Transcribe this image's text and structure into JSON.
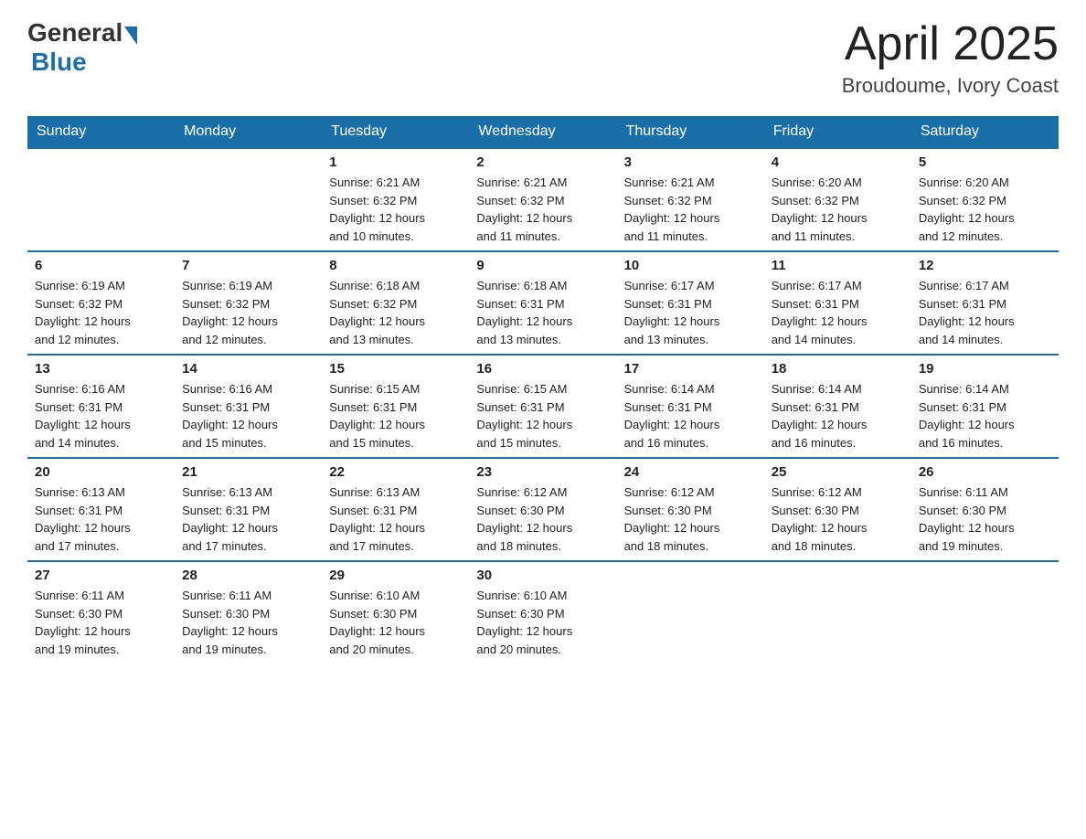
{
  "header": {
    "logo": {
      "general": "General",
      "blue": "Blue"
    },
    "title": "April 2025",
    "location": "Broudoume, Ivory Coast"
  },
  "columns": [
    "Sunday",
    "Monday",
    "Tuesday",
    "Wednesday",
    "Thursday",
    "Friday",
    "Saturday"
  ],
  "weeks": [
    [
      {
        "day": "",
        "info": ""
      },
      {
        "day": "",
        "info": ""
      },
      {
        "day": "1",
        "info": "Sunrise: 6:21 AM\nSunset: 6:32 PM\nDaylight: 12 hours\nand 10 minutes."
      },
      {
        "day": "2",
        "info": "Sunrise: 6:21 AM\nSunset: 6:32 PM\nDaylight: 12 hours\nand 11 minutes."
      },
      {
        "day": "3",
        "info": "Sunrise: 6:21 AM\nSunset: 6:32 PM\nDaylight: 12 hours\nand 11 minutes."
      },
      {
        "day": "4",
        "info": "Sunrise: 6:20 AM\nSunset: 6:32 PM\nDaylight: 12 hours\nand 11 minutes."
      },
      {
        "day": "5",
        "info": "Sunrise: 6:20 AM\nSunset: 6:32 PM\nDaylight: 12 hours\nand 12 minutes."
      }
    ],
    [
      {
        "day": "6",
        "info": "Sunrise: 6:19 AM\nSunset: 6:32 PM\nDaylight: 12 hours\nand 12 minutes."
      },
      {
        "day": "7",
        "info": "Sunrise: 6:19 AM\nSunset: 6:32 PM\nDaylight: 12 hours\nand 12 minutes."
      },
      {
        "day": "8",
        "info": "Sunrise: 6:18 AM\nSunset: 6:32 PM\nDaylight: 12 hours\nand 13 minutes."
      },
      {
        "day": "9",
        "info": "Sunrise: 6:18 AM\nSunset: 6:31 PM\nDaylight: 12 hours\nand 13 minutes."
      },
      {
        "day": "10",
        "info": "Sunrise: 6:17 AM\nSunset: 6:31 PM\nDaylight: 12 hours\nand 13 minutes."
      },
      {
        "day": "11",
        "info": "Sunrise: 6:17 AM\nSunset: 6:31 PM\nDaylight: 12 hours\nand 14 minutes."
      },
      {
        "day": "12",
        "info": "Sunrise: 6:17 AM\nSunset: 6:31 PM\nDaylight: 12 hours\nand 14 minutes."
      }
    ],
    [
      {
        "day": "13",
        "info": "Sunrise: 6:16 AM\nSunset: 6:31 PM\nDaylight: 12 hours\nand 14 minutes."
      },
      {
        "day": "14",
        "info": "Sunrise: 6:16 AM\nSunset: 6:31 PM\nDaylight: 12 hours\nand 15 minutes."
      },
      {
        "day": "15",
        "info": "Sunrise: 6:15 AM\nSunset: 6:31 PM\nDaylight: 12 hours\nand 15 minutes."
      },
      {
        "day": "16",
        "info": "Sunrise: 6:15 AM\nSunset: 6:31 PM\nDaylight: 12 hours\nand 15 minutes."
      },
      {
        "day": "17",
        "info": "Sunrise: 6:14 AM\nSunset: 6:31 PM\nDaylight: 12 hours\nand 16 minutes."
      },
      {
        "day": "18",
        "info": "Sunrise: 6:14 AM\nSunset: 6:31 PM\nDaylight: 12 hours\nand 16 minutes."
      },
      {
        "day": "19",
        "info": "Sunrise: 6:14 AM\nSunset: 6:31 PM\nDaylight: 12 hours\nand 16 minutes."
      }
    ],
    [
      {
        "day": "20",
        "info": "Sunrise: 6:13 AM\nSunset: 6:31 PM\nDaylight: 12 hours\nand 17 minutes."
      },
      {
        "day": "21",
        "info": "Sunrise: 6:13 AM\nSunset: 6:31 PM\nDaylight: 12 hours\nand 17 minutes."
      },
      {
        "day": "22",
        "info": "Sunrise: 6:13 AM\nSunset: 6:31 PM\nDaylight: 12 hours\nand 17 minutes."
      },
      {
        "day": "23",
        "info": "Sunrise: 6:12 AM\nSunset: 6:30 PM\nDaylight: 12 hours\nand 18 minutes."
      },
      {
        "day": "24",
        "info": "Sunrise: 6:12 AM\nSunset: 6:30 PM\nDaylight: 12 hours\nand 18 minutes."
      },
      {
        "day": "25",
        "info": "Sunrise: 6:12 AM\nSunset: 6:30 PM\nDaylight: 12 hours\nand 18 minutes."
      },
      {
        "day": "26",
        "info": "Sunrise: 6:11 AM\nSunset: 6:30 PM\nDaylight: 12 hours\nand 19 minutes."
      }
    ],
    [
      {
        "day": "27",
        "info": "Sunrise: 6:11 AM\nSunset: 6:30 PM\nDaylight: 12 hours\nand 19 minutes."
      },
      {
        "day": "28",
        "info": "Sunrise: 6:11 AM\nSunset: 6:30 PM\nDaylight: 12 hours\nand 19 minutes."
      },
      {
        "day": "29",
        "info": "Sunrise: 6:10 AM\nSunset: 6:30 PM\nDaylight: 12 hours\nand 20 minutes."
      },
      {
        "day": "30",
        "info": "Sunrise: 6:10 AM\nSunset: 6:30 PM\nDaylight: 12 hours\nand 20 minutes."
      },
      {
        "day": "",
        "info": ""
      },
      {
        "day": "",
        "info": ""
      },
      {
        "day": "",
        "info": ""
      }
    ]
  ]
}
